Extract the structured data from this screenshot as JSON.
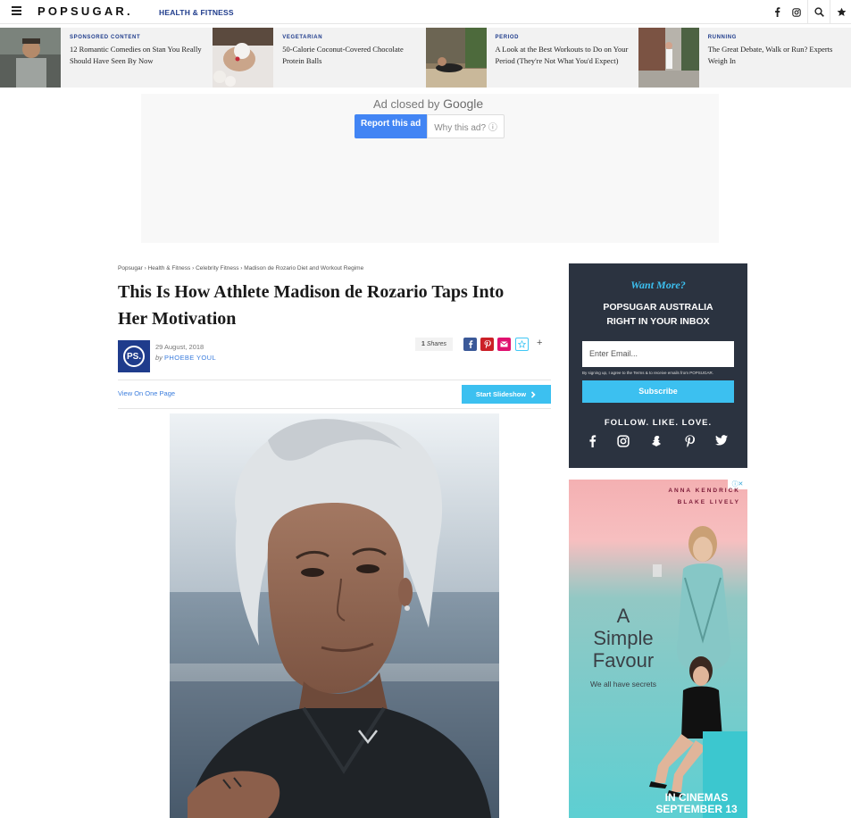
{
  "nav": {
    "logo": "POPSUGAR.",
    "section": "HEALTH & FITNESS",
    "icons": [
      "menu-icon",
      "facebook-icon",
      "instagram-icon",
      "search-icon",
      "star-icon"
    ]
  },
  "trending": [
    {
      "kicker": "SPONSORED CONTENT",
      "title": "12 Romantic Comedies on Stan You Really Should Have Seen By Now"
    },
    {
      "kicker": "VEGETARIAN",
      "title": "50-Calorie Coconut-Covered Chocolate Protein Balls"
    },
    {
      "kicker": "PERIOD",
      "title": "A Look at the Best Workouts to Do on Your Period (They're Not What You'd Expect)"
    },
    {
      "kicker": "RUNNING",
      "title": "The Great Debate, Walk or Run? Experts Weigh In"
    }
  ],
  "ad": {
    "closed_text": "Ad closed by",
    "closed_brand": "Google",
    "report_label": "Report this ad",
    "why_label": "Why this ad? ⓘ"
  },
  "article": {
    "breadcrumb": [
      "Popsugar",
      "Health & Fitness",
      "Celebrity Fitness",
      "Madison de Rozario Diet and Workout Regime"
    ],
    "headline": "This Is How Athlete Madison de Rozario Taps Into Her Motivation",
    "date": "29 August, 2018",
    "by_prefix": "by",
    "author": "PHOEBE YOUL",
    "avatar_text": "PS.",
    "shares_count": "1",
    "shares_label": "Shares",
    "view_one_page": "View On One Page",
    "start_slideshow": "Start Slideshow"
  },
  "newsletter": {
    "want_more": "Want More?",
    "heading_line1": "POPSUGAR AUSTRALIA",
    "heading_line2": "RIGHT IN YOUR INBOX",
    "email_placeholder": "Enter Email...",
    "fine_print": "By signing up, I agree to the Terms & to receive emails from POPSUGAR.",
    "subscribe": "Subscribe",
    "follow": "FOLLOW. LIKE. LOVE.",
    "socials": [
      "facebook-icon",
      "instagram-icon",
      "snapchat-icon",
      "pinterest-icon",
      "twitter-icon"
    ]
  },
  "movie_ad": {
    "actor1": "ANNA KENDRICK",
    "actor2": "BLAKE LIVELY",
    "title_line1": "A",
    "title_line2": "Simple",
    "title_line3": "Favour",
    "tagline": "We all have secrets",
    "release_line1": "IN CINEMAS",
    "release_line2": "SEPTEMBER 13"
  },
  "colors": {
    "brand_blue": "#1f3c8c",
    "accent_cyan": "#3cc0f0",
    "link_blue": "#3b7ddd",
    "newsletter_bg": "#2b3340"
  }
}
